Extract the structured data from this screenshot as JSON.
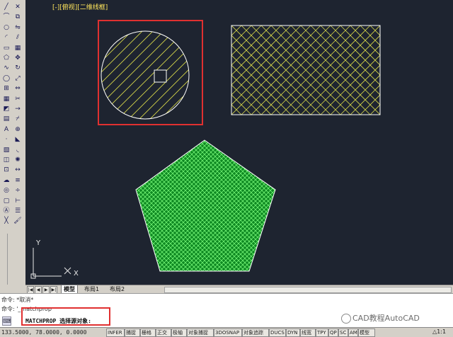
{
  "viewport_label": "[-][俯视][二维线框]",
  "toolbar": {
    "draw_tools": [
      "line-icon",
      "pline-icon",
      "circle-icon",
      "arc-icon",
      "rect-icon",
      "polygon-icon",
      "spline-icon",
      "ellipse-icon",
      "insert-icon",
      "hatch-icon",
      "region-icon",
      "table-icon",
      "text-icon",
      "point-icon",
      "gradient-icon",
      "boundary-icon",
      "block-icon",
      "revcloud-icon",
      "donut-icon",
      "wipeout-icon",
      "mtext-icon",
      "xline-icon"
    ],
    "modify_tools": [
      "erase-icon",
      "copy-icon",
      "mirror-icon",
      "offset-icon",
      "array-icon",
      "move-icon",
      "rotate-icon",
      "scale-icon",
      "stretch-icon",
      "trim-icon",
      "extend-icon",
      "break-icon",
      "join-icon",
      "chamfer-icon",
      "fillet-icon",
      "explode-icon",
      "lengthen-icon",
      "align-icon",
      "divide-icon",
      "measure-icon",
      "properties-icon",
      "matchprop-icon"
    ]
  },
  "ucs": {
    "y_label": "Y",
    "x_label": "X"
  },
  "layout_tabs": [
    {
      "label": "模型",
      "active": true
    },
    {
      "label": "布局1",
      "active": false
    },
    {
      "label": "布局2",
      "active": false
    }
  ],
  "command_history": [
    "命令: *取消*",
    "命令: '_matchprop"
  ],
  "command_prompt": "MATCHPROP 选择源对象:",
  "watermark": "CAD教程AutoCAD",
  "status": {
    "coordinates": "133.5000, 78.0000, 0.0000",
    "buttons": [
      "INFER",
      "捕捉",
      "栅格",
      "正交",
      "极轴",
      "对象捕捉",
      "3DOSNAP",
      "对象追踪",
      "DUCS",
      "DYN",
      "线宽",
      "TPY",
      "QP",
      "SC",
      "AM",
      "模型"
    ],
    "scale": "1:1"
  },
  "colors": {
    "canvas_bg": "#1e2430",
    "hatch_yellow": "#d8d84a",
    "hatch_green": "#7fff7f",
    "fill_green": "#0f8a22",
    "highlight_red": "#e03030",
    "outline_white": "#ffffff"
  }
}
